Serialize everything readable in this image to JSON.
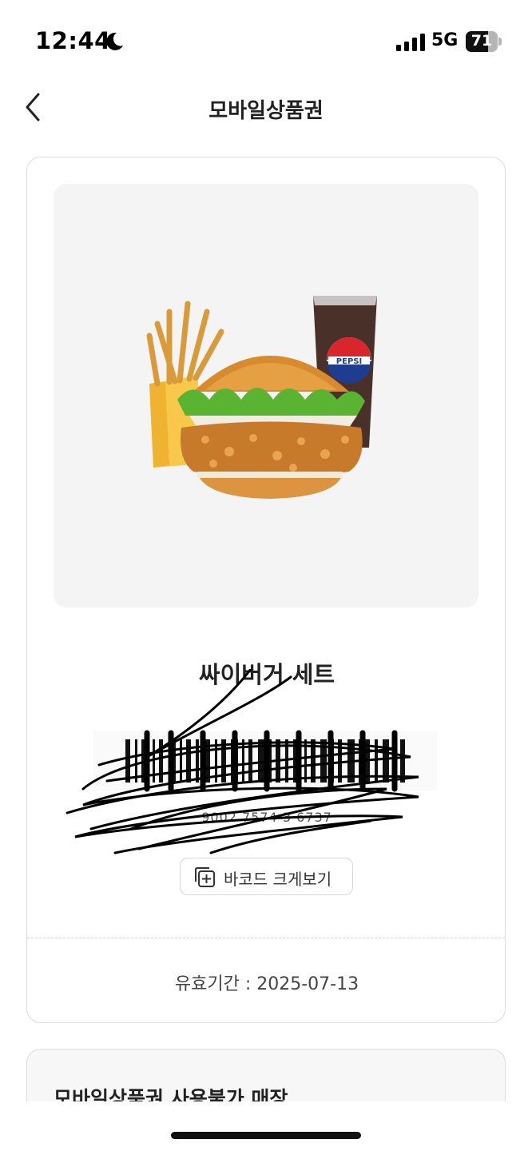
{
  "status_bar": {
    "time": "12:44",
    "network": "5G",
    "battery_level": "71",
    "battery_fraction": 0.71,
    "icons": [
      "moon-icon",
      "signal-bars-icon",
      "battery-icon"
    ]
  },
  "nav": {
    "title": "모바일상품권",
    "back_icon": "chevron-left-icon"
  },
  "voucher": {
    "product_name": "싸이버거 세트",
    "barcode_number": "9002 7574 3 6737",
    "enlarge_label": "바코드 크게보기",
    "enlarge_icon": "plus-square-icon",
    "expiry": "유효기간 : 2025-07-13"
  },
  "info_card": {
    "title": "모바일상품권 사용불가 매장"
  },
  "colors": {
    "card_border": "#dcdcdc",
    "image_bg": "#f4f4f4",
    "text_primary": "#222222"
  }
}
